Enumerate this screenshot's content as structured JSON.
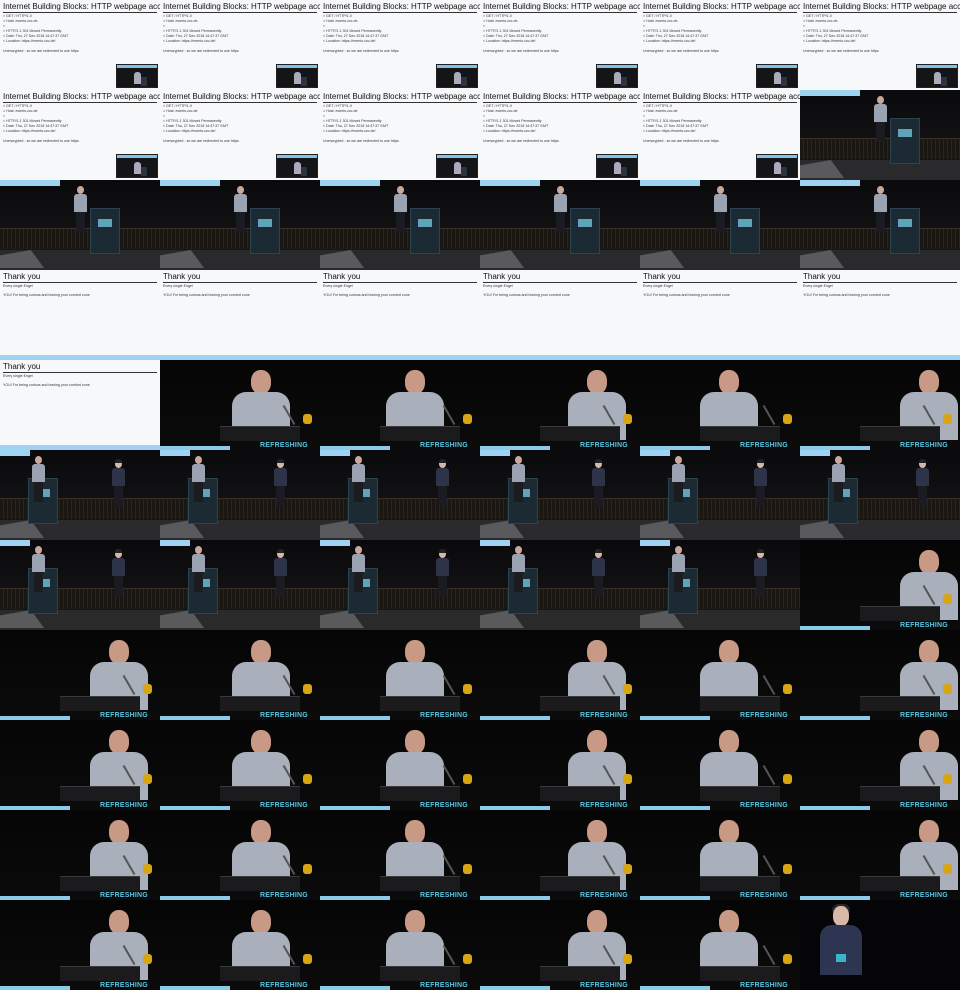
{
  "grid": {
    "columns": 6,
    "rows": 11
  },
  "slide_http": {
    "title": "Internet Building Blocks: HTTP webpage access",
    "lines": [
      "> GET / HTTP/1.0",
      "> Host: events.ccc.de",
      "<",
      "< HTTP/1.1 301 Moved Permanently",
      "< Date: Thu, 27 Dec 2018 14:47:37 GMT",
      "< Location: https://events.ccc.de/"
    ],
    "note": "Unencrypted - so we are redirected to use https"
  },
  "slide_thanks": {
    "title": "Thank you",
    "lines": [
      "Every single Engel",
      "YOU! For being curious and leaving your comfort zone"
    ]
  },
  "brand_text": "REFRESHING",
  "frames": [
    "slide_http",
    "slide_http",
    "slide_http",
    "slide_http",
    "slide_http",
    "slide_http",
    "slide_http",
    "slide_http",
    "slide_http",
    "slide_http",
    "slide_http",
    "stage_man",
    "stage_man",
    "stage_man",
    "stage_man",
    "stage_man",
    "stage_man",
    "stage_man",
    "slide_thanks",
    "slide_thanks",
    "slide_thanks",
    "slide_thanks",
    "slide_thanks",
    "slide_thanks",
    "slide_thanks",
    "close_man",
    "close_man",
    "close_man",
    "close_man",
    "close_man",
    "stage_duo",
    "stage_duo",
    "stage_duo",
    "stage_duo",
    "stage_duo",
    "stage_duo",
    "stage_duo",
    "stage_duo",
    "stage_duo",
    "stage_duo",
    "stage_duo",
    "close_man",
    "close_man",
    "close_man",
    "close_man",
    "close_man",
    "close_man",
    "close_man",
    "close_man",
    "close_man",
    "close_man",
    "close_man",
    "close_man",
    "close_man",
    "close_man",
    "close_man",
    "close_man",
    "close_man",
    "close_man",
    "close_man",
    "close_man",
    "close_man",
    "close_man",
    "close_man",
    "close_man",
    "close_woman"
  ]
}
